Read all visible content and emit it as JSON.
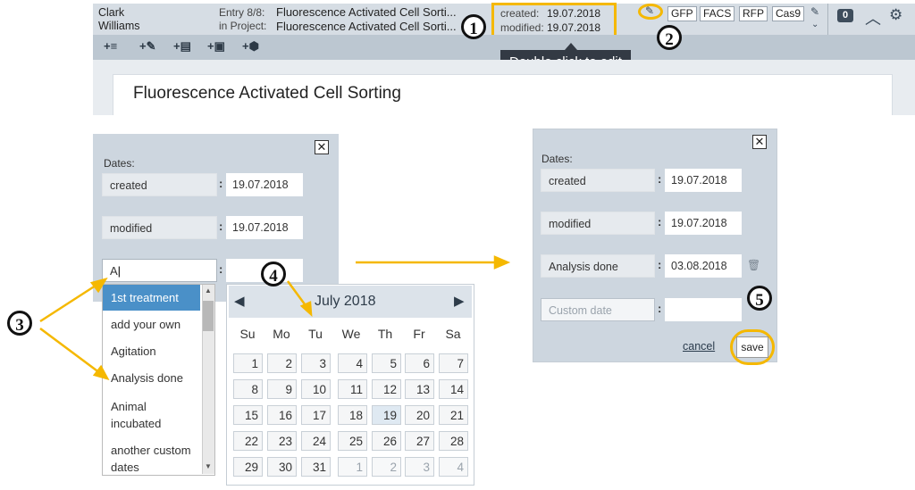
{
  "header": {
    "user_first": "Clark",
    "user_last": "Williams",
    "entry_label": "Entry 8/8:",
    "project_label": "in Project:",
    "entry_name": "Fluorescence Activated Cell Sorti...",
    "project_name": "Fluorescence Activated Cell Sorti...",
    "created_label": "created:",
    "created_value": "19.07.2018",
    "modified_label": "modified:",
    "modified_value": "19.07.2018",
    "tags": [
      "GFP",
      "FACS",
      "RFP",
      "Cas9"
    ],
    "comment_count": "0"
  },
  "toolbar": {
    "items": [
      "+≡",
      "+✎",
      "+▤",
      "+▣",
      "+⬢"
    ]
  },
  "tooltip": "Double click to edit",
  "page_title": "Fluorescence Activated Cell Sorting",
  "dialog_left": {
    "dates_label": "Dates:",
    "rows": [
      {
        "label": "created",
        "value": "19.07.2018"
      },
      {
        "label": "modified",
        "value": "19.07.2018"
      }
    ],
    "input_value": "A",
    "suggestions": [
      "1st treatment",
      "add your own",
      "Agitation",
      "Analysis done",
      "Animal incubated",
      "another custom dates"
    ]
  },
  "calendar": {
    "month": "July 2018",
    "weekdays": [
      "Su",
      "Mo",
      "Tu",
      "We",
      "Th",
      "Fr",
      "Sa"
    ],
    "weeks": [
      [
        "1",
        "2",
        "3",
        "4",
        "5",
        "6",
        "7"
      ],
      [
        "8",
        "9",
        "10",
        "11",
        "12",
        "13",
        "14"
      ],
      [
        "15",
        "16",
        "17",
        "18",
        "19",
        "20",
        "21"
      ],
      [
        "22",
        "23",
        "24",
        "25",
        "26",
        "27",
        "28"
      ],
      [
        "29",
        "30",
        "31",
        "1",
        "2",
        "3",
        "4"
      ]
    ]
  },
  "dialog_right": {
    "dates_label": "Dates:",
    "rows": [
      {
        "label": "created",
        "value": "19.07.2018"
      },
      {
        "label": "modified",
        "value": "19.07.2018"
      },
      {
        "label": "Analysis done",
        "value": "03.08.2018"
      }
    ],
    "custom_placeholder": "Custom date",
    "cancel_label": "cancel",
    "save_label": "save"
  },
  "callouts": [
    "1",
    "2",
    "3",
    "4",
    "5"
  ],
  "colors": {
    "highlight": "#f5b800",
    "panel": "#cdd6df",
    "header": "#d6dde4",
    "selected": "#4a90c8"
  }
}
